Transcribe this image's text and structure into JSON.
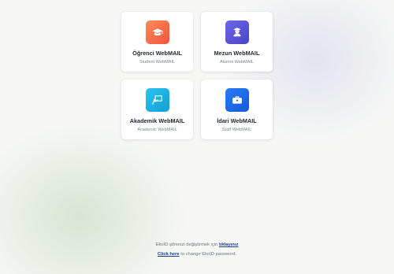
{
  "cards": [
    {
      "title": "Öğrenci WebMAIL",
      "subtitle": "Student WebMAIL",
      "icon": "graduation-cap-icon",
      "color": "#f46a44"
    },
    {
      "title": "Mezun WebMAIL",
      "subtitle": "Alumni WebMAIL",
      "icon": "graduate-user-icon",
      "color": "#5a55d6"
    },
    {
      "title": "Akademik WebMAIL",
      "subtitle": "Academic WebMAIL",
      "icon": "presentation-board-icon",
      "color": "#1eb0e2"
    },
    {
      "title": "İdari WebMAIL",
      "subtitle": "Staff WebMAIL",
      "icon": "briefcase-icon",
      "color": "#1e6ae8"
    }
  ],
  "footer": {
    "tr_text": "EkoID şifrenizi değiştirmek için",
    "tr_link": "tıklayınız",
    "en_link": "Click here",
    "en_text": "to change EkoID password."
  }
}
